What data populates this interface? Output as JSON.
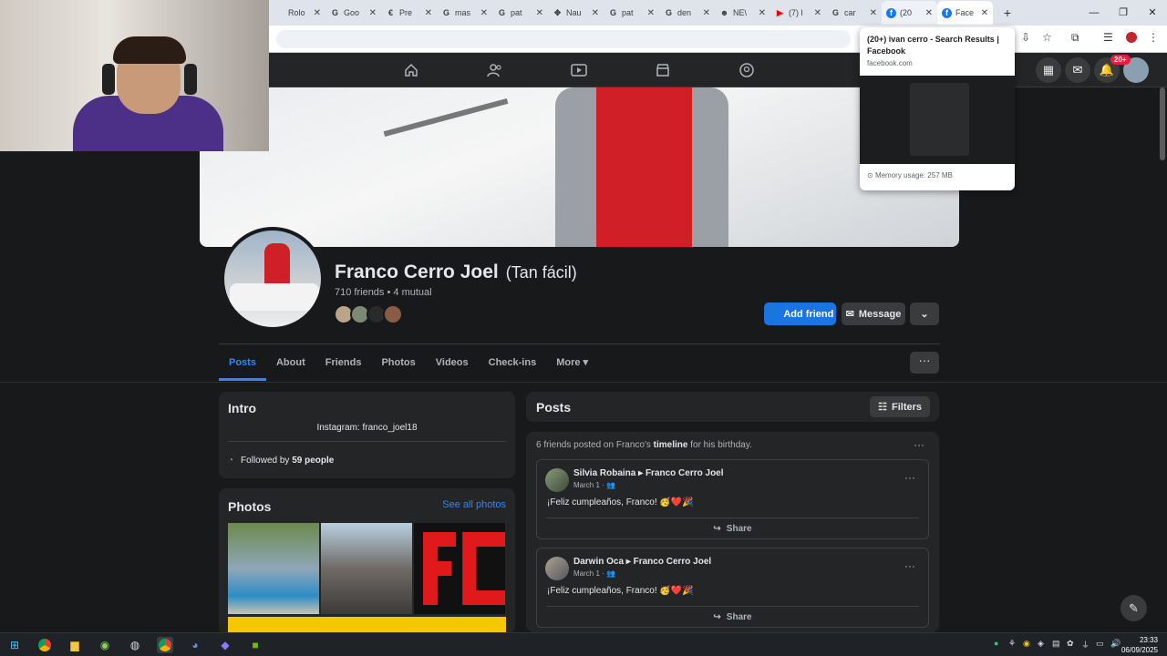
{
  "browser": {
    "tabs": [
      {
        "label": "Rolo",
        "icon": "",
        "active": false
      },
      {
        "label": "Goo",
        "icon": "G",
        "active": false
      },
      {
        "label": "Pre",
        "icon": "€",
        "active": false
      },
      {
        "label": "mas",
        "icon": "G",
        "active": false
      },
      {
        "label": "pat",
        "icon": "G",
        "active": false
      },
      {
        "label": "Nau",
        "icon": "✥",
        "active": false
      },
      {
        "label": "pat",
        "icon": "G",
        "active": false
      },
      {
        "label": "den",
        "icon": "G",
        "active": false
      },
      {
        "label": "NE\\",
        "icon": "☻",
        "active": false
      },
      {
        "label": "(7) l",
        "icon": "▶",
        "active": false
      },
      {
        "label": "car",
        "icon": "G",
        "active": false
      },
      {
        "label": "(20",
        "icon": "f",
        "active": false,
        "hover": true
      },
      {
        "label": "Face",
        "icon": "f",
        "active": true
      }
    ],
    "tooltip": {
      "title": "(20+) ivan cerro - Search Results | Facebook",
      "url": "facebook.com",
      "memory": "Memory usage: 257 MB"
    },
    "notifications_badge": "20+"
  },
  "profile": {
    "name": "Franco Cerro Joel",
    "alt_name": "(Tan fácil)",
    "friends": "710 friends • 4 mutual",
    "add_friend": "Add friend",
    "message": "Message"
  },
  "tabs": [
    "Posts",
    "About",
    "Friends",
    "Photos",
    "Videos",
    "Check-ins",
    "More"
  ],
  "intro": {
    "title": "Intro",
    "bio": "Instagram: franco_joel18",
    "followed_prefix": "Followed by ",
    "followed_count": "59 people"
  },
  "photos": {
    "title": "Photos",
    "see_all": "See all photos"
  },
  "posts": {
    "title": "Posts",
    "filters": "Filters",
    "birthday_prefix": "6 friends posted on Franco's ",
    "birthday_bold": "timeline",
    "birthday_suffix": " for his birthday.",
    "items": [
      {
        "author": "Silvia Robaina",
        "target": "Franco Cerro Joel",
        "date": "March 1 · ",
        "message": "¡Feliz cumpleaños, Franco! 🥳❤️🎉",
        "share": "Share"
      },
      {
        "author": "Darwin Oca",
        "target": "Franco Cerro Joel",
        "date": "March 1 · ",
        "message": "¡Feliz cumpleaños, Franco! 🥳❤️🎉",
        "share": "Share"
      }
    ]
  },
  "taskbar": {
    "time": "23:33",
    "date": "06/09/2025"
  },
  "colors": {
    "accent": "#1b74e4",
    "link": "#2d88ff",
    "card": "#242526",
    "background": "#18191a"
  }
}
